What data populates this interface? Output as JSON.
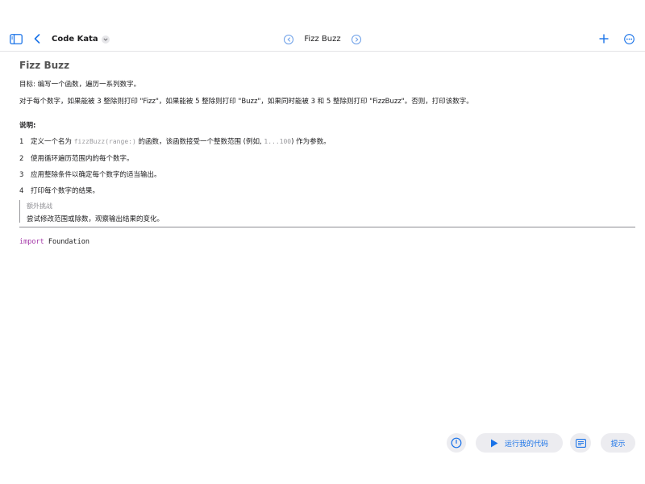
{
  "toolbar": {
    "app_title": "Code Kata",
    "page_title": "Fizz Buzz"
  },
  "doc": {
    "title": "Fizz Buzz",
    "goal": "目标: 编写一个函数，遍历一系列数字。",
    "rule": "对于每个数字，如果能被 3 整除则打印 \"Fizz\"，如果能被 5 整除则打印 \"Buzz\"，如果同时能被 3 和 5 整除则打印 \"FizzBuzz\"。否则，打印该数字。",
    "notes_heading": "说明:",
    "steps": [
      {
        "num": "1",
        "pre": "定义一个名为 ",
        "code": "fizzBuzz(range:)",
        "mid": " 的函数，该函数接受一个整数范围 (例如, ",
        "code2": "1...100",
        "post": ") 作为参数。"
      },
      {
        "num": "2",
        "text": "使用循环遍历范围内的每个数字。"
      },
      {
        "num": "3",
        "text": "应用整除条件以确定每个数字的适当输出。"
      },
      {
        "num": "4",
        "text": "打印每个数字的结果。"
      }
    ],
    "extra_title": "额外挑战",
    "extra_body": "尝试修改范围或除数，观察输出结果的变化。"
  },
  "code": {
    "keyword": "import",
    "module": " Foundation"
  },
  "bottom": {
    "run_label": "运行我的代码",
    "hint_label": "提示"
  },
  "colors": {
    "accent": "#1a73e8",
    "keyword": "#a438a8",
    "pill_bg": "#ececf0"
  }
}
